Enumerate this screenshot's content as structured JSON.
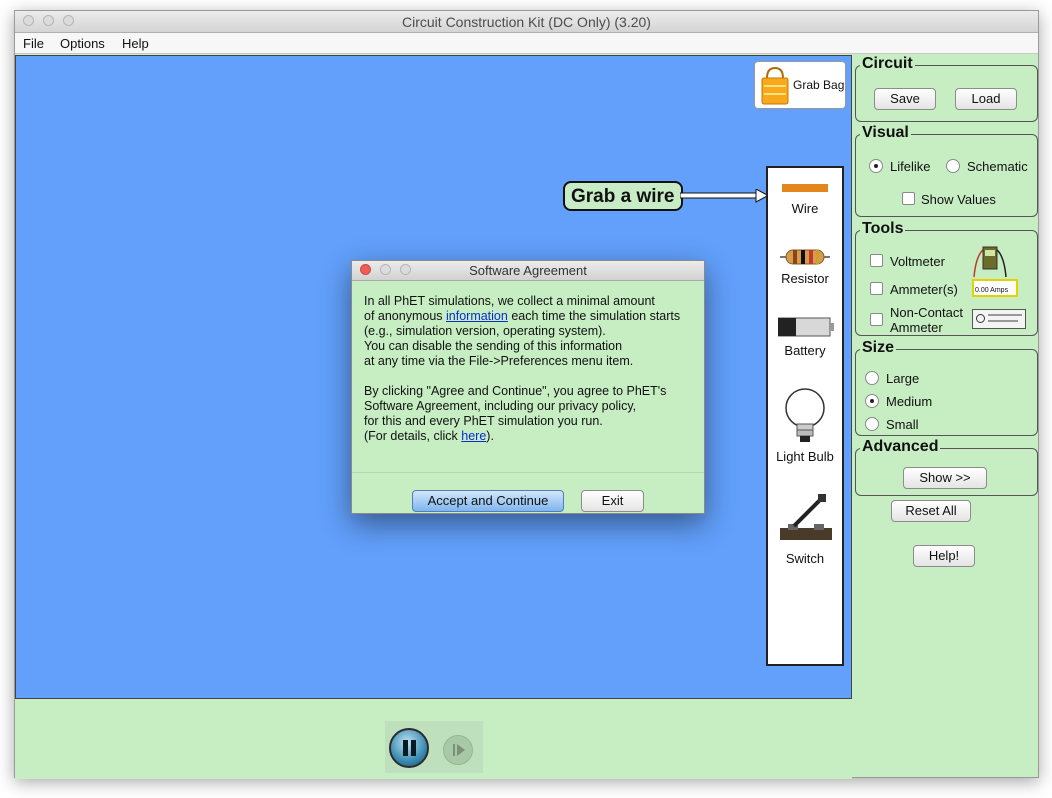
{
  "window": {
    "title": "Circuit Construction Kit (DC Only) (3.20)"
  },
  "menu": [
    "File",
    "Options",
    "Help"
  ],
  "grab_bag": {
    "label": "Grab Bag"
  },
  "callout": "Grab a wire",
  "toolbox": {
    "items": [
      "Wire",
      "Resistor",
      "Battery",
      "Light Bulb",
      "Switch"
    ]
  },
  "dialog": {
    "title": "Software Agreement",
    "lines": [
      {
        "text": "In all PhET simulations, we collect a minimal amount"
      },
      {
        "pre": "of anonymous ",
        "link": "information",
        "post": " each time the simulation starts"
      },
      {
        "text": "(e.g., simulation version, operating system)."
      },
      {
        "text": "You can disable the sending of this information"
      },
      {
        "text": "at any time via the File->Preferences menu item."
      },
      {
        "text": ""
      },
      {
        "text": "By clicking \"Agree and Continue\", you agree to PhET's"
      },
      {
        "text": "Software Agreement, including our privacy policy,"
      },
      {
        "text": "for this and every PhET simulation you run."
      },
      {
        "pre": "(For details, click ",
        "link": "here",
        "post": ")."
      }
    ],
    "accept_label": "Accept and Continue",
    "exit_label": "Exit"
  },
  "panels": {
    "circuit": {
      "title": "Circuit",
      "save": "Save",
      "load": "Load"
    },
    "visual": {
      "title": "Visual",
      "lifelike": "Lifelike",
      "schematic": "Schematic",
      "show_values": "Show Values",
      "selected": "Lifelike"
    },
    "tools": {
      "title": "Tools",
      "voltmeter": "Voltmeter",
      "ammeter": "Ammeter(s)",
      "noncontact_1": "Non-Contact",
      "noncontact_2": "Ammeter",
      "ammeter_readout": "0.00 Amps"
    },
    "size": {
      "title": "Size",
      "options": [
        "Large",
        "Medium",
        "Small"
      ],
      "selected": "Medium"
    },
    "advanced": {
      "title": "Advanced",
      "show": "Show >>"
    }
  },
  "reset_label": "Reset All",
  "help_label": "Help!",
  "playback": {
    "state": "paused"
  }
}
